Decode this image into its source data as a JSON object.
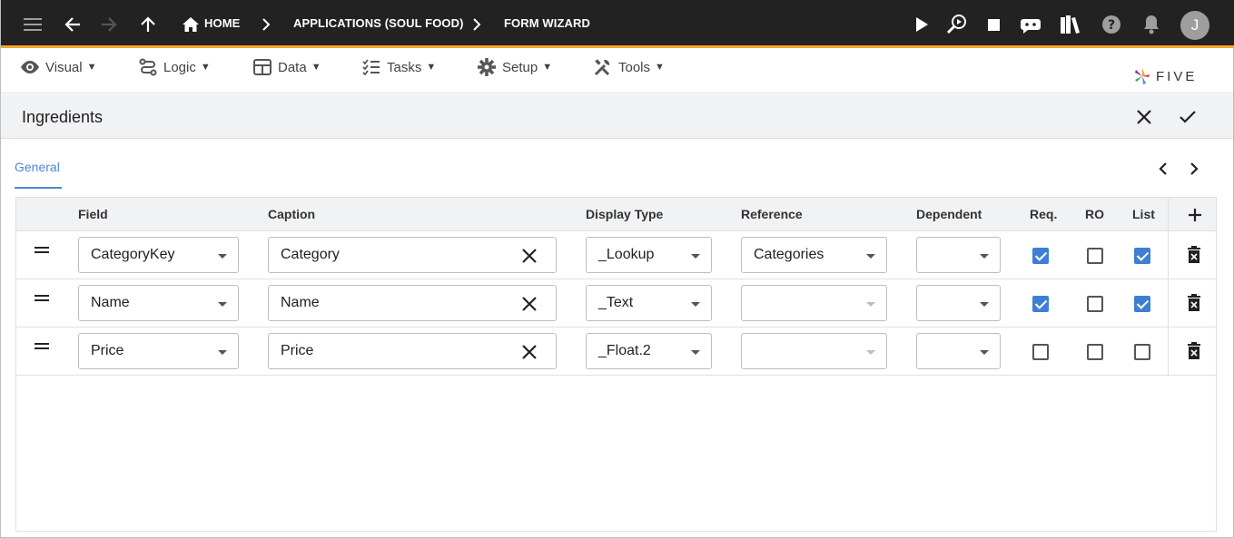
{
  "topbar": {
    "breadcrumbs": [
      "HOME",
      "APPLICATIONS (SOUL FOOD)",
      "FORM WIZARD"
    ],
    "avatar_initial": "J"
  },
  "menu": {
    "items": [
      {
        "label": "Visual",
        "icon": "eye-icon"
      },
      {
        "label": "Logic",
        "icon": "logic-flow-icon"
      },
      {
        "label": "Data",
        "icon": "table-icon"
      },
      {
        "label": "Tasks",
        "icon": "checklist-icon"
      },
      {
        "label": "Setup",
        "icon": "gear-icon"
      },
      {
        "label": "Tools",
        "icon": "tools-icon"
      }
    ],
    "caret": "▼"
  },
  "logo": {
    "text": "FIVE"
  },
  "form": {
    "title": "Ingredients"
  },
  "tabs": [
    {
      "label": "General",
      "active": true
    }
  ],
  "grid": {
    "columns": [
      "Field",
      "Caption",
      "Display Type",
      "Reference",
      "Dependent",
      "Req.",
      "RO",
      "List"
    ],
    "rows": [
      {
        "field": "CategoryKey",
        "caption": "Category",
        "display_type": "_Lookup",
        "reference": "Categories",
        "dependent": "",
        "req": true,
        "ro": false,
        "list": true
      },
      {
        "field": "Name",
        "caption": "Name",
        "display_type": "_Text",
        "reference": "",
        "dependent": "",
        "req": true,
        "ro": false,
        "list": true
      },
      {
        "field": "Price",
        "caption": "Price",
        "display_type": "_Float.2",
        "reference": "",
        "dependent": "",
        "req": false,
        "ro": false,
        "list": false
      }
    ]
  },
  "colors": {
    "accent": "#4a8ad4",
    "topbar": "#222222",
    "topbar_border": "#f5a623",
    "checkbox": "#3f7fd1"
  }
}
